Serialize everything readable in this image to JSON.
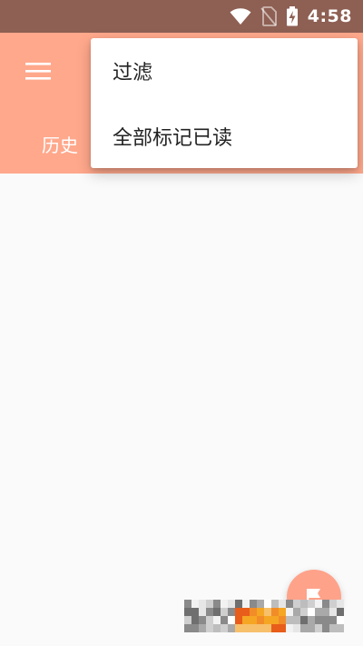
{
  "status_bar": {
    "time": "4:58",
    "icons": [
      "wifi-icon",
      "no-sim-icon",
      "battery-charging-icon"
    ]
  },
  "app_bar": {
    "menu_icon": "menu-icon",
    "tab_label": "历史"
  },
  "overflow_menu": {
    "items": [
      {
        "label": "过滤"
      },
      {
        "label": "全部标记已读"
      }
    ]
  },
  "fab": {
    "icon": "flag-icon"
  },
  "colors": {
    "status_bar": "#8e5f53",
    "app_bar": "#ffa88c",
    "fab": "#ffa28a",
    "background": "#fafafa"
  }
}
